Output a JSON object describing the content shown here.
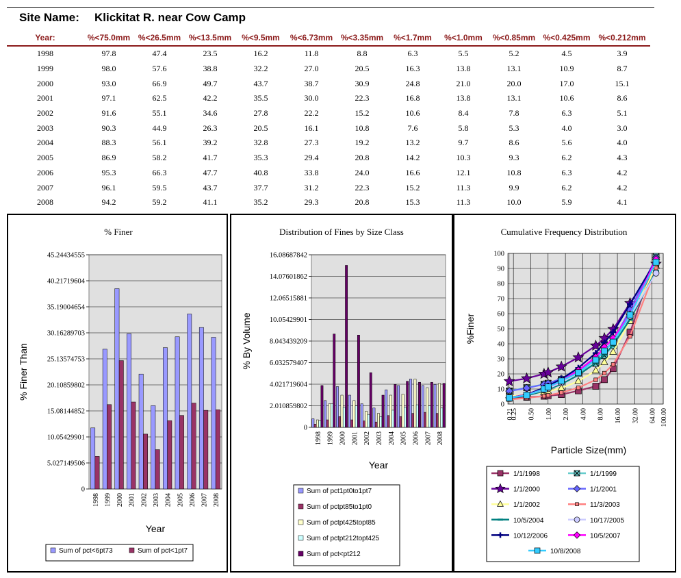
{
  "site": {
    "label": "Site Name:",
    "name": "Klickitat R. near Cow Camp"
  },
  "table": {
    "headers": [
      "Year:",
      "%<75.0mm",
      "%<26.5mm",
      "%<13.5mm",
      "%<9.5mm",
      "%<6.73mm",
      "%<3.35mm",
      "%<1.7mm",
      "%<1.0mm",
      "%<0.85mm",
      "%<0.425mm",
      "%<0.212mm"
    ],
    "rows": [
      [
        "1998",
        "97.8",
        "47.4",
        "23.5",
        "16.2",
        "11.8",
        "8.8",
        "6.3",
        "5.5",
        "5.2",
        "4.5",
        "3.9"
      ],
      [
        "1999",
        "98.0",
        "57.6",
        "38.8",
        "32.2",
        "27.0",
        "20.5",
        "16.3",
        "13.8",
        "13.1",
        "10.9",
        "8.7"
      ],
      [
        "2000",
        "93.0",
        "66.9",
        "49.7",
        "43.7",
        "38.7",
        "30.9",
        "24.8",
        "21.0",
        "20.0",
        "17.0",
        "15.1"
      ],
      [
        "2001",
        "97.1",
        "62.5",
        "42.2",
        "35.5",
        "30.0",
        "22.3",
        "16.8",
        "13.8",
        "13.1",
        "10.6",
        "8.6"
      ],
      [
        "2002",
        "91.6",
        "55.1",
        "34.6",
        "27.8",
        "22.2",
        "15.2",
        "10.6",
        "8.4",
        "7.8",
        "6.3",
        "5.1"
      ],
      [
        "2003",
        "90.3",
        "44.9",
        "26.3",
        "20.5",
        "16.1",
        "10.8",
        "7.6",
        "5.8",
        "5.3",
        "4.0",
        "3.0"
      ],
      [
        "2004",
        "88.3",
        "56.1",
        "39.2",
        "32.8",
        "27.3",
        "19.2",
        "13.2",
        "9.7",
        "8.6",
        "5.6",
        "4.0"
      ],
      [
        "2005",
        "86.9",
        "58.2",
        "41.7",
        "35.3",
        "29.4",
        "20.8",
        "14.2",
        "10.3",
        "9.3",
        "6.2",
        "4.3"
      ],
      [
        "2006",
        "95.3",
        "66.3",
        "47.7",
        "40.8",
        "33.8",
        "24.0",
        "16.6",
        "12.1",
        "10.8",
        "6.3",
        "4.2"
      ],
      [
        "2007",
        "96.1",
        "59.5",
        "43.7",
        "37.7",
        "31.2",
        "22.3",
        "15.2",
        "11.3",
        "9.9",
        "6.2",
        "4.2"
      ],
      [
        "2008",
        "94.2",
        "59.2",
        "41.1",
        "35.2",
        "29.3",
        "20.8",
        "15.3",
        "11.3",
        "10.0",
        "5.9",
        "4.1"
      ]
    ]
  },
  "chart_data": [
    {
      "type": "bar",
      "title": "% Finer",
      "xlabel": "Year",
      "ylabel": "% Finer Than",
      "categories": [
        "1998",
        "1999",
        "2000",
        "2001",
        "2002",
        "2003",
        "2004",
        "2005",
        "2006",
        "2007",
        "2008"
      ],
      "ylim": [
        0,
        45.24434555
      ],
      "yticks": [
        "0",
        "5.027149506",
        "10.05429901",
        "15.08144852",
        "20.10859802",
        "25.13574753",
        "30.16289703",
        "35.19004654",
        "40.21719604",
        "45.24434555"
      ],
      "series": [
        {
          "name": "Sum of pct<6pt73",
          "color": "#9999ff",
          "values": [
            11.8,
            27.0,
            38.7,
            30.0,
            22.2,
            16.1,
            27.3,
            29.4,
            33.8,
            31.2,
            29.3
          ]
        },
        {
          "name": "Sum of pct<1pt7",
          "color": "#993366",
          "values": [
            6.3,
            16.3,
            24.8,
            16.8,
            10.6,
            7.6,
            13.2,
            14.2,
            16.6,
            15.2,
            15.3
          ]
        }
      ],
      "grid": true,
      "legend": "bottom"
    },
    {
      "type": "bar",
      "title": "Distribution of Fines by Size Class",
      "xlabel": "Year",
      "ylabel": "% By Volume",
      "categories": [
        "1998",
        "1999",
        "2000",
        "2001",
        "2002",
        "2003",
        "2004",
        "2005",
        "2006",
        "2007",
        "2008"
      ],
      "ylim": [
        0,
        16.08687842
      ],
      "yticks": [
        "0",
        "2.010859802",
        "4.021719604",
        "6.032579407",
        "8.043439209",
        "10.05429901",
        "12.06515881",
        "14.07601862",
        "16.08687842"
      ],
      "series": [
        {
          "name": "Sum of pct1pt0to1pt7",
          "color": "#9999ff",
          "values": [
            0.8,
            2.5,
            3.8,
            3.0,
            2.2,
            1.8,
            3.5,
            3.9,
            4.5,
            3.9,
            4.0
          ]
        },
        {
          "name": "Sum of pctpt85to1pt0",
          "color": "#993366",
          "values": [
            0.3,
            0.7,
            1.0,
            0.7,
            0.6,
            0.5,
            1.1,
            1.0,
            1.3,
            1.4,
            1.3
          ]
        },
        {
          "name": "Sum of pctpt425topt85",
          "color": "#ffffcc",
          "values": [
            0.7,
            2.2,
            3.0,
            2.5,
            1.5,
            1.3,
            3.0,
            3.1,
            4.5,
            3.7,
            4.1
          ]
        },
        {
          "name": "Sum of pctpt212topt425",
          "color": "#ccffff",
          "values": [
            0.6,
            2.2,
            1.9,
            2.0,
            1.2,
            1.0,
            1.6,
            1.9,
            2.1,
            2.0,
            1.8
          ]
        },
        {
          "name": "Sum of pct<pt212",
          "color": "#660066",
          "values": [
            3.9,
            8.7,
            15.1,
            8.6,
            5.1,
            3.0,
            4.0,
            4.3,
            4.2,
            4.2,
            4.1
          ]
        }
      ],
      "grid": true,
      "legend": "bottom"
    },
    {
      "type": "line",
      "title": "Cumulative Frequency Distribution",
      "xlabel": "Particle Size(mm)",
      "ylabel": "%Finer",
      "xscale": "log",
      "xticks": [
        "0.25",
        "0.21",
        "0.50",
        "1.00",
        "2.00",
        "4.00",
        "8.00",
        "16.00",
        "32.00",
        "64.00",
        "100.00"
      ],
      "ylim": [
        0,
        100
      ],
      "yticks": [
        "0",
        "10",
        "20",
        "30",
        "40",
        "50",
        "60",
        "70",
        "80",
        "90",
        "100"
      ],
      "x": [
        0.212,
        0.425,
        0.85,
        1.0,
        1.7,
        3.35,
        6.73,
        9.5,
        13.5,
        26.5,
        75.0
      ],
      "series": [
        {
          "name": "1/1/1998",
          "color": "#993366",
          "marker": "square",
          "values": [
            3.9,
            4.5,
            5.2,
            5.5,
            6.3,
            8.8,
            11.8,
            16.2,
            23.5,
            47.4,
            97.8
          ]
        },
        {
          "name": "1/1/1999",
          "color": "#66cccc",
          "marker": "x",
          "values": [
            8.7,
            10.9,
            13.1,
            13.8,
            16.3,
            20.5,
            27.0,
            32.2,
            38.8,
            57.6,
            98.0
          ]
        },
        {
          "name": "1/1/2000",
          "color": "#660099",
          "marker": "star",
          "values": [
            15.1,
            17.0,
            20.0,
            21.0,
            24.8,
            30.9,
            38.7,
            43.7,
            49.7,
            66.9,
            93.0
          ]
        },
        {
          "name": "1/1/2001",
          "color": "#6666ff",
          "marker": "diamond",
          "values": [
            8.6,
            10.6,
            13.1,
            13.8,
            16.8,
            22.3,
            30.0,
            35.5,
            42.2,
            62.5,
            97.1
          ]
        },
        {
          "name": "1/1/2002",
          "color": "#ffff99",
          "marker": "triangle",
          "values": [
            5.1,
            6.3,
            7.8,
            8.4,
            10.6,
            15.2,
            22.2,
            27.8,
            34.6,
            55.1,
            91.6
          ]
        },
        {
          "name": "11/3/2003",
          "color": "#ff8080",
          "marker": "small-square",
          "values": [
            3.0,
            4.0,
            5.3,
            5.8,
            7.6,
            10.8,
            16.1,
            20.5,
            26.3,
            44.9,
            90.3
          ]
        },
        {
          "name": "10/5/2004",
          "color": "#008080",
          "marker": "dash",
          "values": [
            4.0,
            5.6,
            8.6,
            9.7,
            13.2,
            19.2,
            27.3,
            32.8,
            39.2,
            56.1,
            88.3
          ]
        },
        {
          "name": "10/17/2005",
          "color": "#ccccff",
          "marker": "circle",
          "values": [
            4.3,
            6.2,
            9.3,
            10.3,
            14.2,
            20.8,
            29.4,
            35.3,
            41.7,
            58.2,
            86.9
          ]
        },
        {
          "name": "10/12/2006",
          "color": "#000080",
          "marker": "plus",
          "values": [
            4.2,
            6.3,
            10.8,
            12.1,
            16.6,
            24.0,
            33.8,
            40.8,
            47.7,
            66.3,
            95.3
          ]
        },
        {
          "name": "10/5/2007",
          "color": "#ff00ff",
          "marker": "diamond",
          "values": [
            4.2,
            6.2,
            9.9,
            11.3,
            15.2,
            22.3,
            31.2,
            37.7,
            43.7,
            59.5,
            96.1
          ]
        },
        {
          "name": "10/8/2008",
          "color": "#33ccff",
          "marker": "square",
          "values": [
            4.1,
            5.9,
            10.0,
            11.3,
            15.3,
            20.8,
            29.3,
            35.2,
            41.1,
            59.2,
            94.2
          ]
        }
      ],
      "grid": true,
      "legend": "bottom"
    }
  ]
}
